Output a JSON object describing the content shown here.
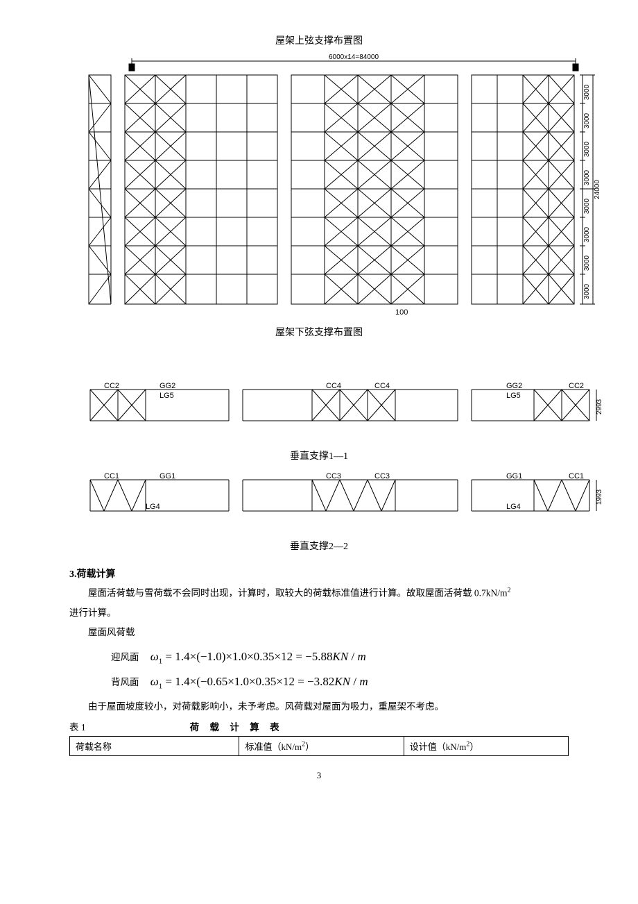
{
  "diagram1": {
    "caption": "屋架上弦支撑布置图",
    "top_dim": "6000x14=84000"
  },
  "diagram2": {
    "caption": "屋架下弦支撑布置图",
    "side_dims": [
      "3000",
      "3000",
      "3000",
      "3000",
      "3000",
      "3000",
      "3000",
      "3000"
    ],
    "total_dim": "24000",
    "bottom_text": "100"
  },
  "vert1": {
    "caption": "垂直支撑1—1",
    "labels": {
      "CC2": "CC2",
      "GG2": "GG2",
      "LG5": "LG5",
      "CC4": "CC4",
      "side_dim": "2993"
    }
  },
  "vert2": {
    "caption": "垂直支撑2—2",
    "labels": {
      "CC1": "CC1",
      "GG1": "GG1",
      "LG4": "LG4",
      "CC3": "CC3",
      "side_dim": "1993"
    }
  },
  "section3": {
    "title": "3.荷载计算",
    "para1_a": "屋面活荷载与雪荷载不会同时出现，计算时，取较大的荷载标准值进行计算。故取屋面活荷载 0.7kN/",
    "para1_b": "进行计算。",
    "para2": "屋面风荷载",
    "formula1_label": "迎风面",
    "formula1": "ω₁ = 1.4×(−1.0)×1.0×0.35×12 = −5.88KN / m",
    "formula2_label": "背风面",
    "formula2": "ω₁ = 1.4×(−0.65×1.0×0.35×12 = −3.82KN / m",
    "para3": "由于屋面坡度较小，对荷载影响小，未予考虑。风荷载对屋面为吸力，重屋架不考虑。",
    "table_label": "表 1",
    "table_title": "荷 载 计 算 表",
    "table_headers": [
      "荷载名称",
      "标准值（kN/",
      "设计值（kN/"
    ],
    "unit": "m",
    "sup": "2",
    "close_paren": "）"
  },
  "page_number": "3"
}
